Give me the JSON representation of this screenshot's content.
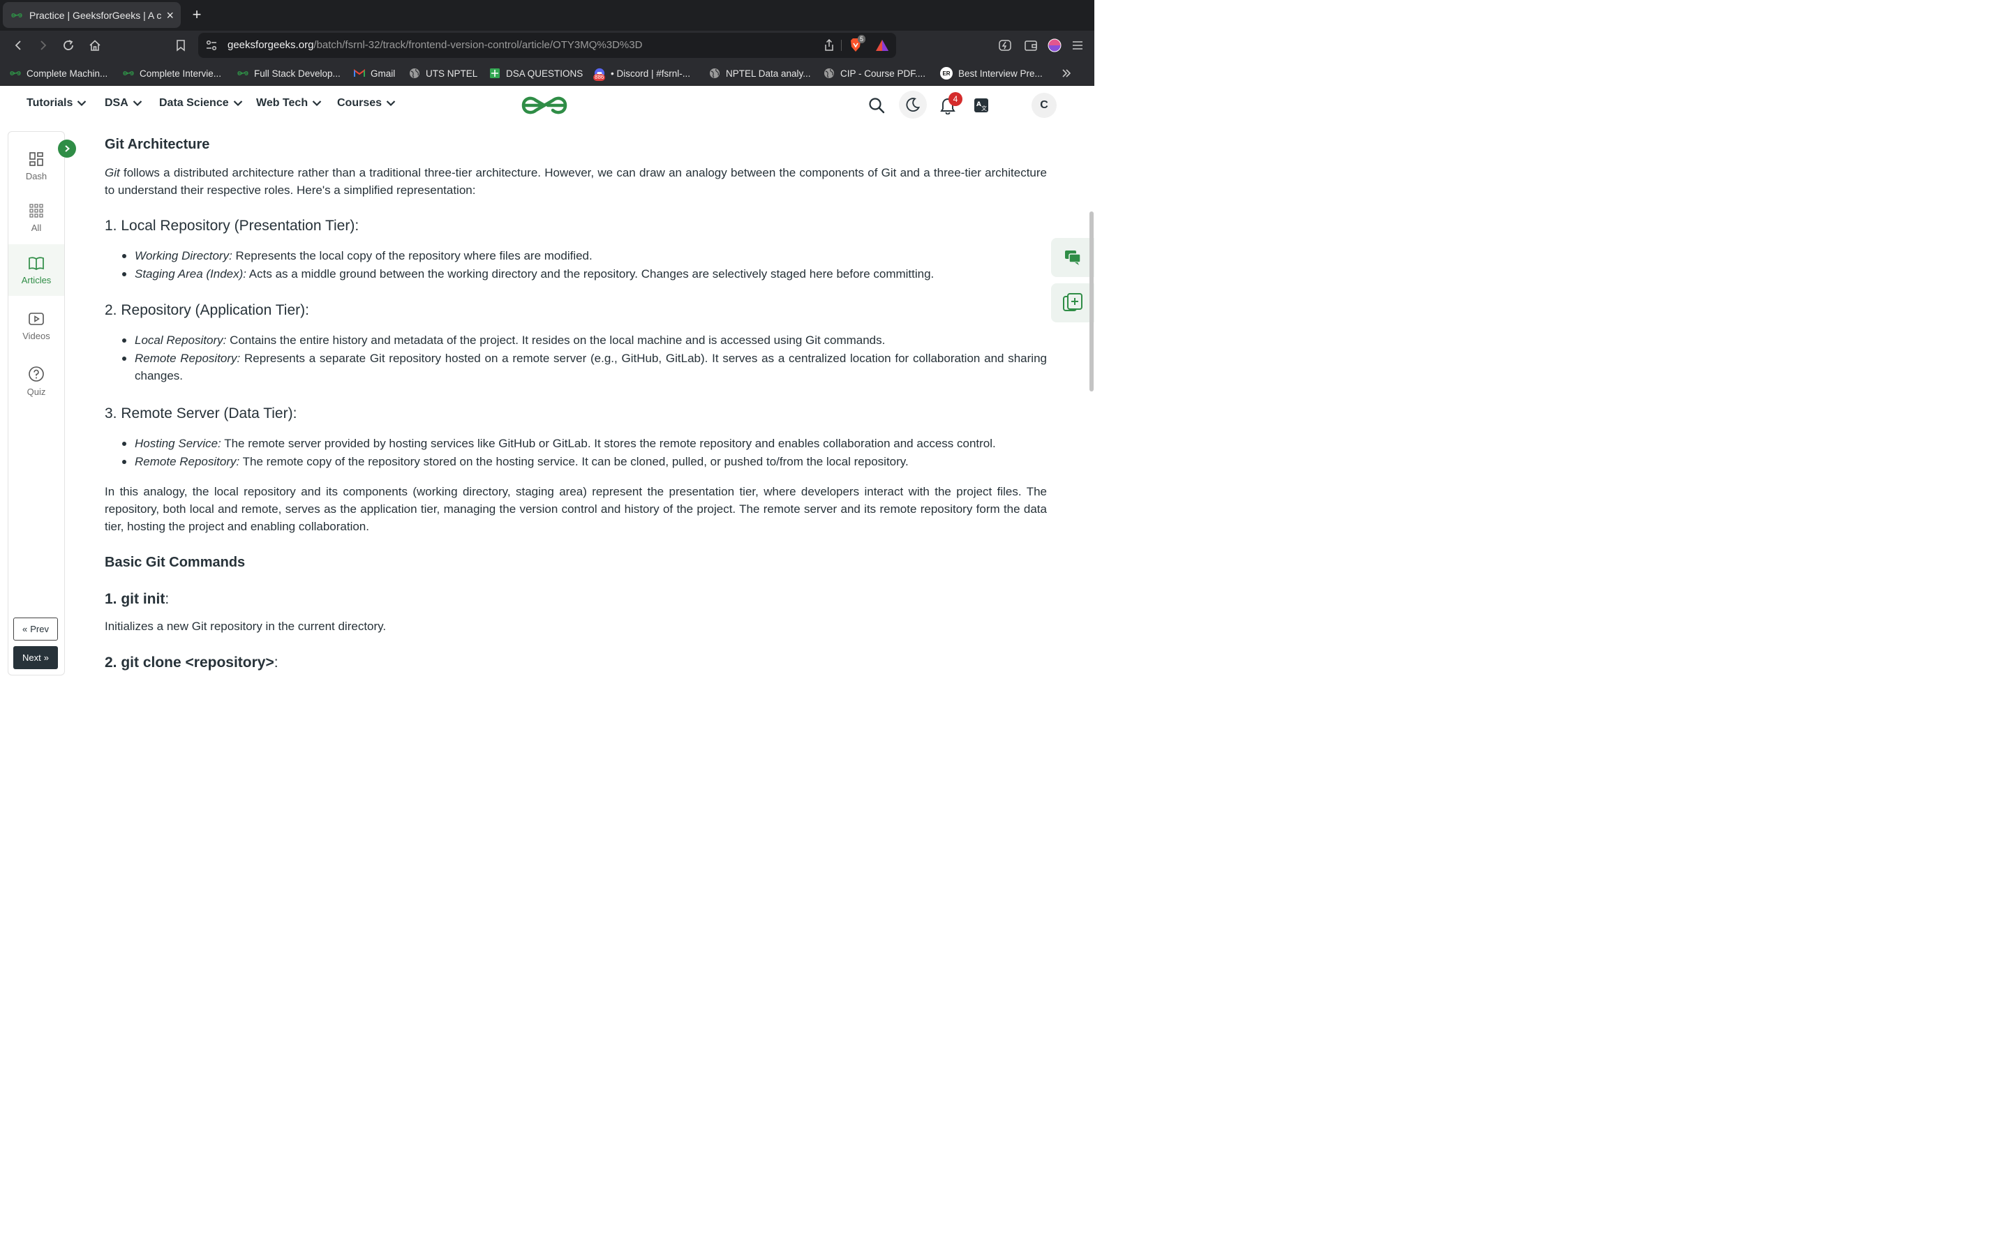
{
  "browser": {
    "tab_title": "Practice | GeeksforGeeks | A c",
    "url_domain": "geeksforgeeks.org",
    "url_path": "/batch/fsrnl-32/track/frontend-version-control/article/OTY3MQ%3D%3D",
    "brave_badge": "5"
  },
  "bookmarks": [
    {
      "label": "Complete Machin..."
    },
    {
      "label": "Complete Intervie..."
    },
    {
      "label": "Full Stack Develop..."
    },
    {
      "label": "Gmail"
    },
    {
      "label": "UTS NPTEL"
    },
    {
      "label": "DSA QUESTIONS"
    },
    {
      "label": "• Discord | #fsrnl-...",
      "badge": "886"
    },
    {
      "label": "NPTEL Data analy..."
    },
    {
      "label": "CIP - Course PDF...."
    },
    {
      "label": "Best Interview Pre...",
      "icon_text": "ER"
    }
  ],
  "header": {
    "nav": [
      "Tutorials",
      "DSA",
      "Data Science",
      "Web Tech",
      "Courses"
    ],
    "notification_count": "4",
    "avatar_letter": "C",
    "accent": "#2f8d46"
  },
  "rail": {
    "items": [
      {
        "label": "Dash",
        "icon": "dashboard-icon"
      },
      {
        "label": "All",
        "icon": "grid-icon"
      },
      {
        "label": "Articles",
        "icon": "book-icon"
      },
      {
        "label": "Videos",
        "icon": "video-icon"
      },
      {
        "label": "Quiz",
        "icon": "question-icon"
      }
    ],
    "prev": "Prev",
    "next": "Next"
  },
  "article": {
    "title": "Git Architecture",
    "intro_git": "Git",
    "intro": " follows a distributed architecture rather than a traditional three-tier architecture. However, we can draw an analogy between the components of Git and a three-tier architecture to understand their respective roles. Here's a simplified representation:",
    "sections": [
      {
        "heading": "1. Local Repository (Presentation Tier):",
        "bullets": [
          {
            "term": "Working Directory:",
            "text": " Represents the local copy of the repository where files are modified."
          },
          {
            "term": "Staging Area (Index):",
            "text": " Acts as a middle ground between the working directory and the repository. Changes are selectively staged here before committing."
          }
        ]
      },
      {
        "heading": "2. Repository (Application Tier):",
        "bullets": [
          {
            "term": "Local Repository:",
            "text": " Contains the entire history and metadata of the project. It resides on the local machine and is accessed using Git commands."
          },
          {
            "term": "Remote Repository:",
            "text": " Represents a separate Git repository hosted on a remote server (e.g., GitHub, GitLab). It serves as a centralized location for collaboration and sharing changes."
          }
        ]
      },
      {
        "heading": "3. Remote Server (Data Tier):",
        "bullets": [
          {
            "term": "Hosting Service:",
            "text": " The remote server provided by hosting services like GitHub or GitLab. It stores the remote repository and enables collaboration and access control."
          },
          {
            "term": "Remote Repository:",
            "text": " The remote copy of the repository stored on the hosting service. It can be cloned, pulled, or pushed to/from the local repository."
          }
        ]
      }
    ],
    "conclusion": "In this analogy, the local repository and its components (working directory, staging area) represent the presentation tier, where developers interact with the project files. The repository, both local and remote, serves as the application tier, managing the version control and history of the project. The remote server and its remote repository form the data tier, hosting the project and enabling collaboration.",
    "commands_title": "Basic Git Commands",
    "cmd1_title": "1. git init",
    "cmd1_desc": "Initializes a new Git repository in the current directory.",
    "cmd2_title": "2. git clone <repository>",
    "colon": ":"
  }
}
